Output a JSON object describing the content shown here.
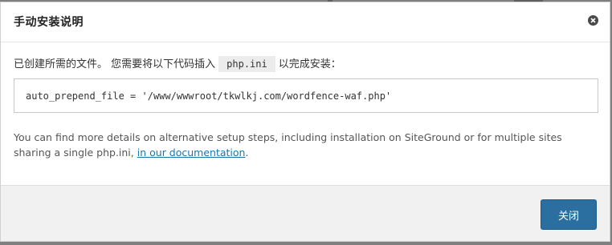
{
  "modal": {
    "title": "手动安装说明",
    "intro_before": "已创建所需的文件。 您需要将以下代码插入",
    "intro_code": "php.ini",
    "intro_after": "以完成安装：",
    "code": "auto_prepend_file = '/www/wwwroot/tkwlkj.com/wordfence-waf.php'",
    "details_text": "You can find more details on alternative setup steps, including installation on SiteGround or for multiple sites sharing a single php.ini,",
    "details_link": "in our documentation",
    "details_end": ".",
    "close_button_label": "关闭"
  },
  "colors": {
    "primary_button": "#2a6fa0",
    "link": "#1a76a8",
    "footer_bg": "#f1f1f1"
  },
  "icons": {
    "close": "close-icon"
  }
}
